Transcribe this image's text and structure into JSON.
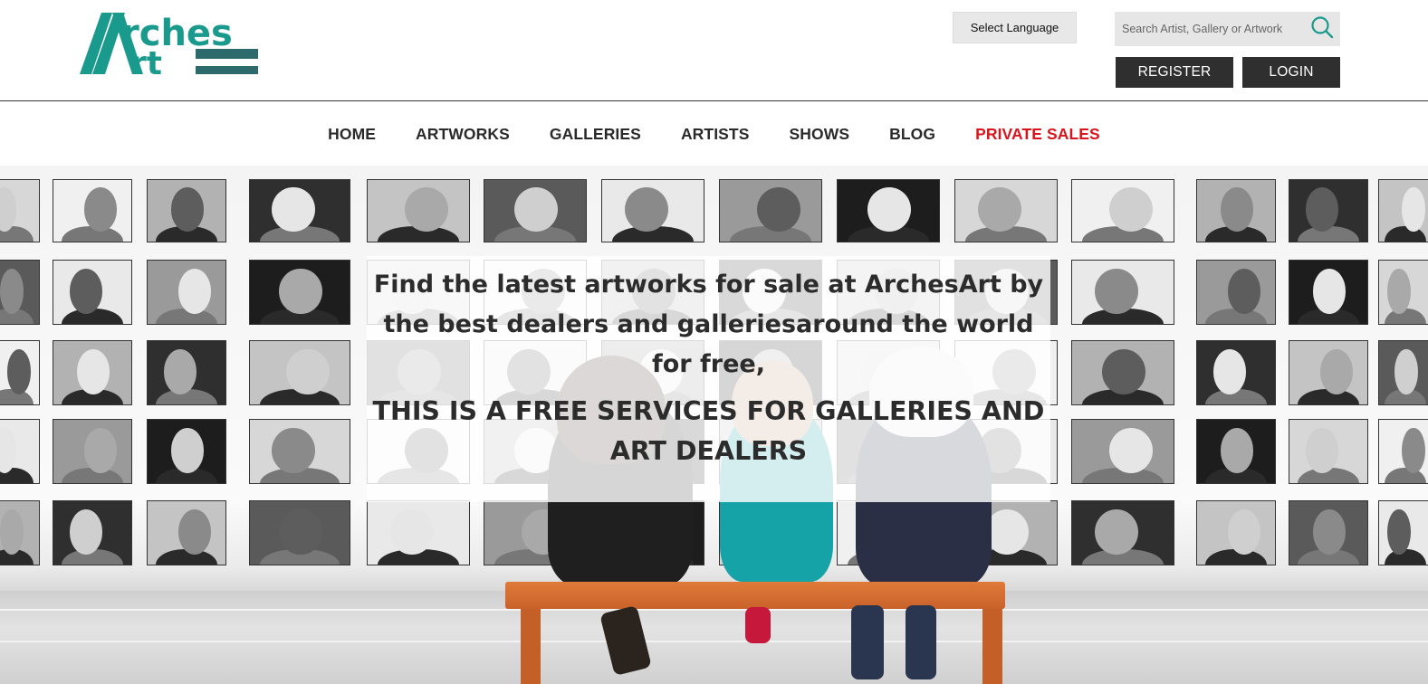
{
  "header": {
    "logo": {
      "line1": "Arches",
      "line2": "Art",
      "color": "#1a9a8c",
      "bar_color": "#2d5f63"
    },
    "language": {
      "label": "Select Language"
    },
    "search": {
      "placeholder": "Search Artist, Gallery or Artwork"
    },
    "register_label": "REGISTER",
    "login_label": "LOGIN"
  },
  "nav": {
    "items": [
      {
        "label": "HOME"
      },
      {
        "label": "ARTWORKS"
      },
      {
        "label": "GALLERIES"
      },
      {
        "label": "ARTISTS"
      },
      {
        "label": "SHOWS"
      },
      {
        "label": "BLOG"
      },
      {
        "label": "PRIVATE SALES",
        "accent": "#d9141c"
      }
    ]
  },
  "hero": {
    "headline": "Find the latest artworks for sale at ArchesArt by the best dealers and galleriesaround the world for free,",
    "subline": "THIS IS A FREE SERVICES FOR GALLERIES AND ART DEALERS"
  },
  "colors": {
    "accent": "#1a9a8c",
    "button": "#2f2f2f",
    "private_sales": "#d9141c"
  }
}
